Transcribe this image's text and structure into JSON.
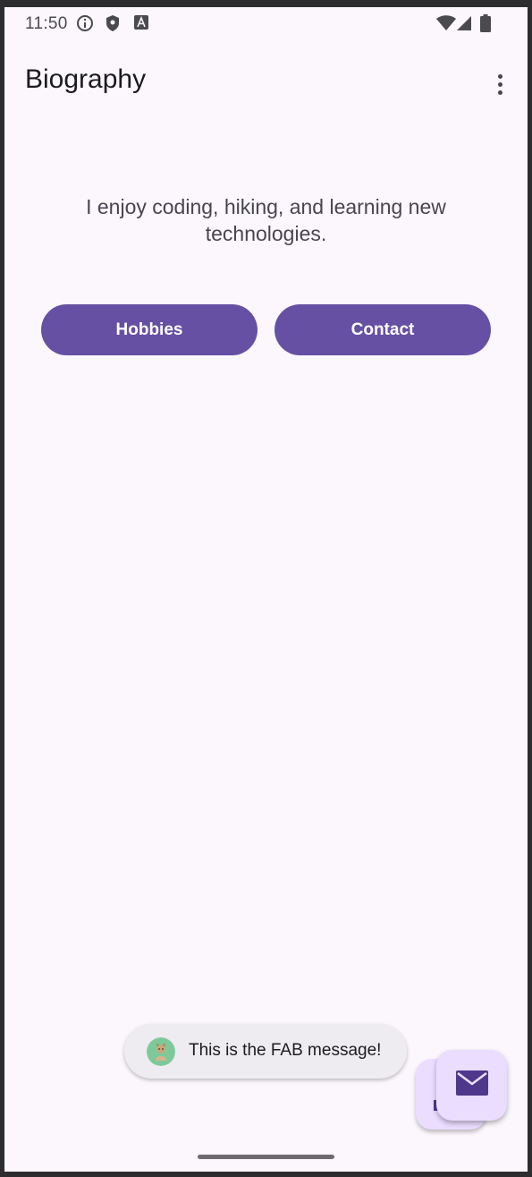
{
  "status_bar": {
    "time": "11:50",
    "icons": [
      "info-icon",
      "shield-icon",
      "font-icon",
      "wifi-icon",
      "signal-icon",
      "battery-icon"
    ]
  },
  "app_bar": {
    "title": "Biography",
    "menu_icon": "more-vert-icon"
  },
  "content": {
    "bio_text": "I enjoy coding, hiking, and learning new technologies.",
    "buttons": {
      "hobbies": "Hobbies",
      "contact": "Contact"
    }
  },
  "toast": {
    "message": "This is the FAB message!",
    "icon": "app-avatar-icon"
  },
  "fab": {
    "icon": "mail-icon"
  },
  "colors": {
    "background": "#fcf7fc",
    "primary": "#6650a4",
    "fab_container": "#eaddff",
    "fab_icon": "#4f378b",
    "toast_background": "#eeecf0"
  }
}
